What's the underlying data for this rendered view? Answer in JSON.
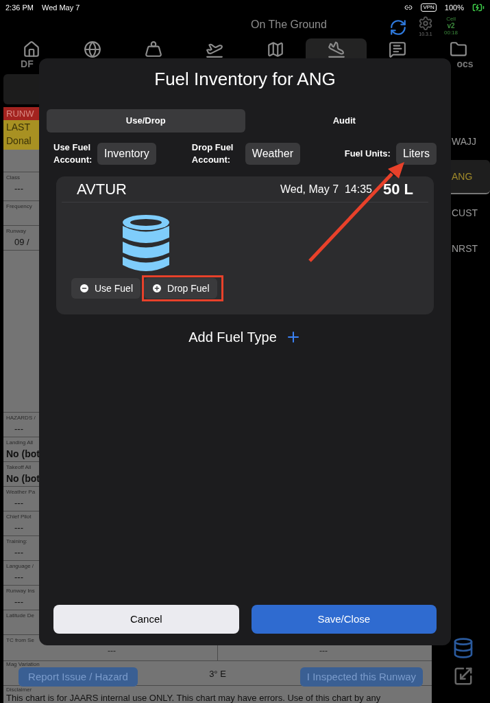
{
  "status_bar": {
    "time": "2:36 PM",
    "date": "Wed May 7",
    "vpn": "VPN",
    "battery": "100%"
  },
  "header": {
    "title": "On The Ground",
    "version": "10.3.1",
    "network": "Cell",
    "app_version": "v2",
    "timer": "00:18"
  },
  "nav_tabs": [
    {
      "kind": "home",
      "label": "DF",
      "selected": false
    },
    {
      "kind": "globe",
      "selected": false
    },
    {
      "kind": "weight",
      "selected": false
    },
    {
      "kind": "takeoff",
      "selected": false
    },
    {
      "kind": "map",
      "selected": false
    },
    {
      "kind": "landing",
      "selected": true
    },
    {
      "kind": "message",
      "selected": false
    },
    {
      "kind": "folder",
      "label": "ocs",
      "selected": false
    }
  ],
  "airport_panel": {
    "banner_red": "RUNW",
    "banner_yellow": [
      "LAST",
      "Donal"
    ],
    "fields_top": [
      {
        "label": "Class",
        "value": "---"
      },
      {
        "label": "Frequency"
      },
      {
        "label": "Runway",
        "value": "09 /"
      }
    ],
    "fields": [
      {
        "label": "HAZARDS /",
        "value": "---"
      },
      {
        "label": "Landing All",
        "value": "No (bot"
      },
      {
        "label": "Takeoff All",
        "value": "No (bot"
      },
      {
        "label": "Weather Pa",
        "value": "---"
      },
      {
        "label": "Chief Pilot",
        "value": "---"
      },
      {
        "label": "Training:",
        "value": "---"
      },
      {
        "label": "Language /",
        "value": "---"
      },
      {
        "label": "Runway Ins",
        "value": "---"
      },
      {
        "label": "Latitude De"
      }
    ],
    "tc_row": {
      "label": "TC from Se",
      "cells": [
        "---",
        "---"
      ]
    },
    "mag_variation": {
      "label": "Mag Variation",
      "value": "3° E"
    },
    "disclaimer": {
      "label": "Disclaimer",
      "text": "This chart is for JAARS internal use ONLY. This chart may have errors. Use of this chart by any"
    },
    "buttons": [
      "Report Issue / Hazard",
      "I Inspected this Runway"
    ]
  },
  "airport_list": [
    {
      "code": "WAJJ",
      "selected": false
    },
    {
      "code": "ANG",
      "selected": true
    },
    {
      "code": "CUST",
      "selected": false
    },
    {
      "code": "NRST",
      "selected": false
    }
  ],
  "modal": {
    "title": "Fuel Inventory for ANG",
    "segments": [
      {
        "label": "Use/Drop",
        "selected": true
      },
      {
        "label": "Audit",
        "selected": false
      }
    ],
    "use_account": {
      "label": "Use Fuel Account:",
      "value": "Inventory"
    },
    "drop_account": {
      "label": "Drop Fuel Account:",
      "value": "Weather"
    },
    "units": {
      "label": "Fuel Units:",
      "value": "Liters"
    },
    "fuel": {
      "name": "AVTUR",
      "date": "Wed, May 7  14:35",
      "amount": "50 L",
      "use_button": "Use Fuel",
      "drop_button": "Drop Fuel"
    },
    "add_label": "Add Fuel Type",
    "cancel": "Cancel",
    "save": "Save/Close"
  }
}
